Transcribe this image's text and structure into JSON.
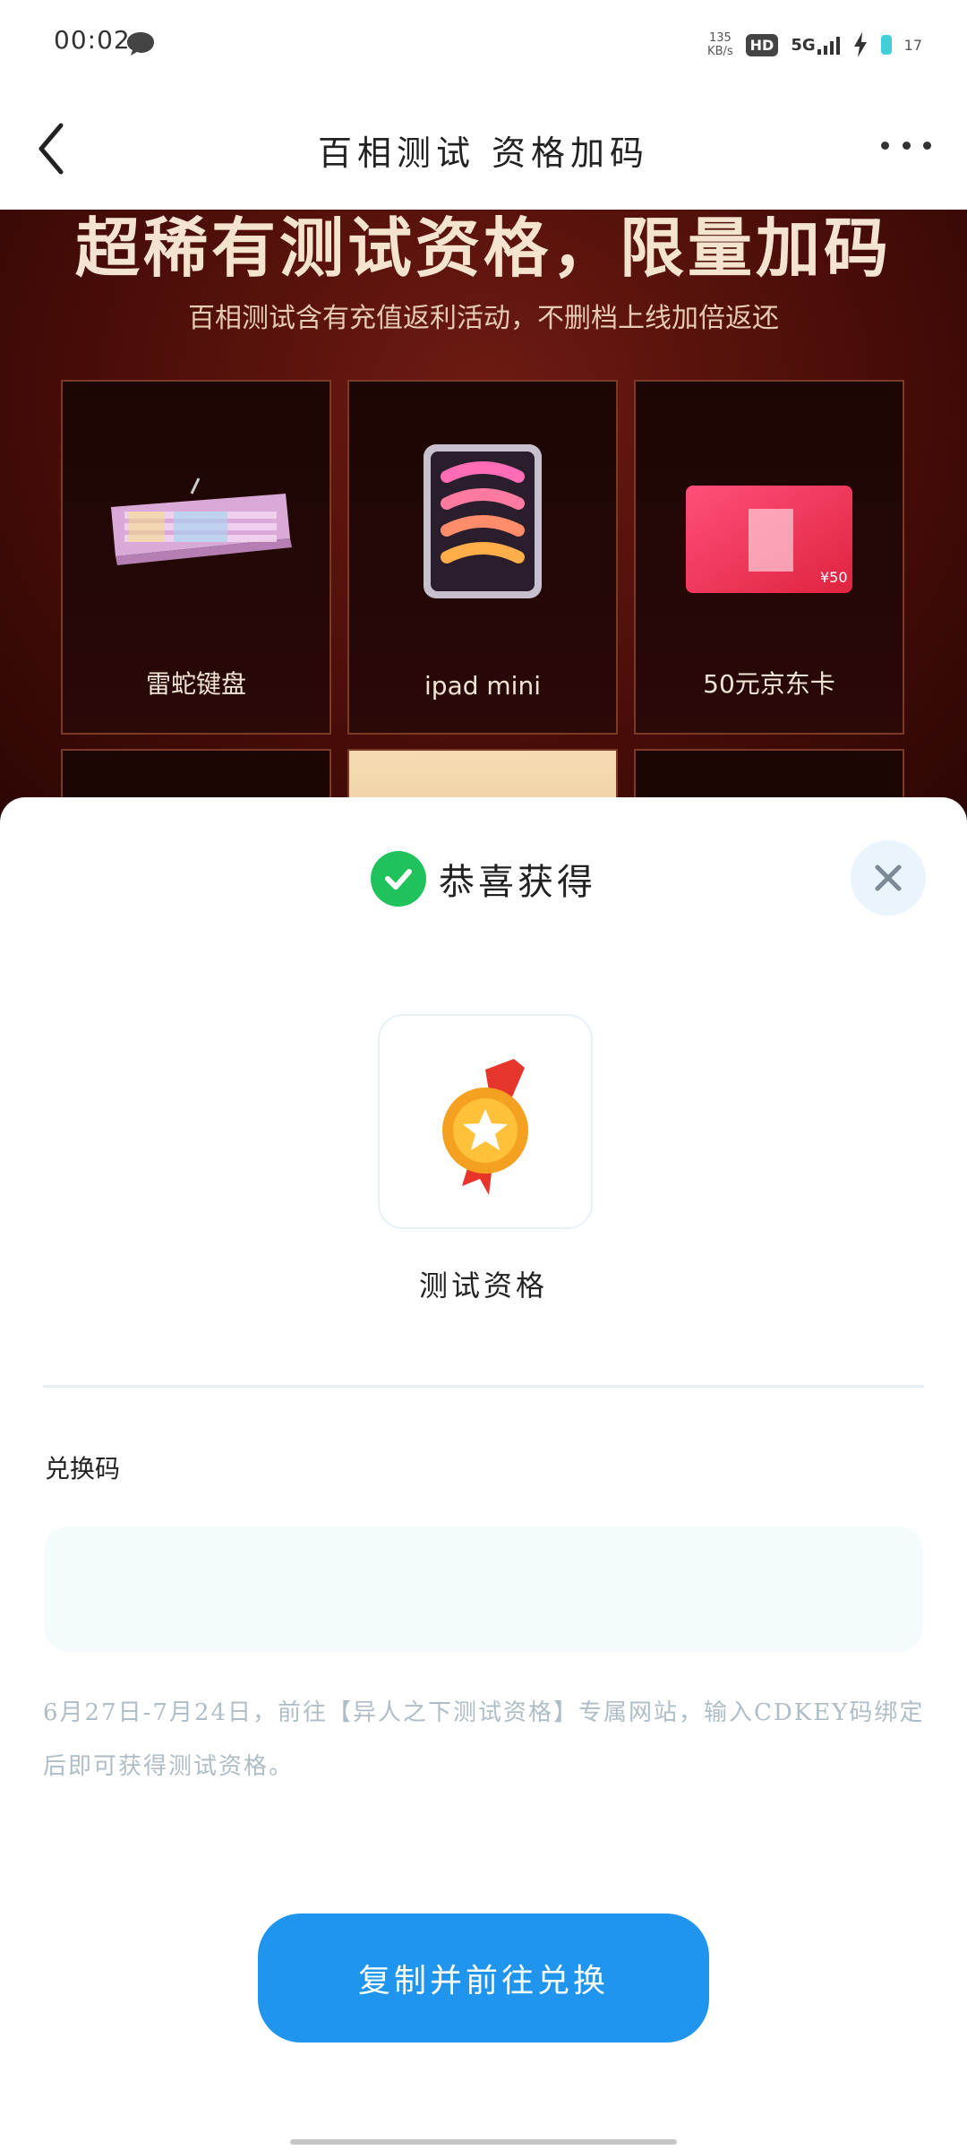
{
  "status_bar": {
    "time": "00:02",
    "speed_value": "135",
    "speed_unit": "KB/s",
    "hd": "HD",
    "network": "5G",
    "battery": "17"
  },
  "header": {
    "title": "百相测试 资格加码"
  },
  "promo": {
    "headline": "超稀有测试资格，限量加码",
    "subtitle": "百相测试含有充值返利活动，不删档上线加倍返还",
    "cards": [
      {
        "label": "雷蛇键盘"
      },
      {
        "label": "ipad mini"
      },
      {
        "label": "50元京东卡"
      }
    ]
  },
  "sheet": {
    "title": "恭喜获得",
    "prize_name": "测试资格",
    "code_label": "兑换码",
    "code_value": "",
    "note": "6月27日-7月24日，前往【异人之下测试资格】专属网站，输入CDKEY码绑定后即可获得测试资格。",
    "cta_label": "复制并前往兑换"
  },
  "colors": {
    "accent": "#1f95ee",
    "success": "#1fc25b",
    "promo_bg": "#4a0d08"
  }
}
